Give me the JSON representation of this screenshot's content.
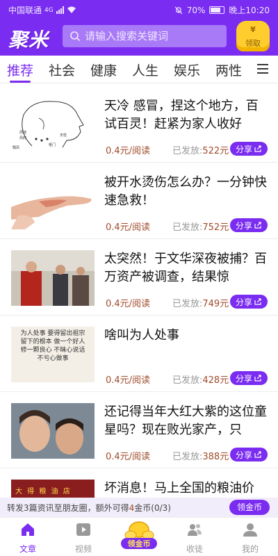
{
  "status_bar": {
    "carrier": "中国联通",
    "network": "4G",
    "battery": "70%",
    "time": "晚上10:20"
  },
  "header": {
    "logo": "聚米",
    "search_placeholder": "请输入搜索关键词",
    "reward_symbol": "¥",
    "reward_label": "领取"
  },
  "tabs": [
    "推荐",
    "社会",
    "健康",
    "人生",
    "娱乐",
    "两性"
  ],
  "active_tab": "推荐",
  "articles": [
    {
      "title": "天冷 感冒，捏这个地方，百试百灵！赶紧为家人收好",
      "price": "0.4元/阅读",
      "issued_label": "已发放:",
      "issued_amount": "522元",
      "share": "分享"
    },
    {
      "title": "被开水烫伤怎么办？一分钟快速急救！",
      "price": "0.4元/阅读",
      "issued_label": "已发放:",
      "issued_amount": "752元",
      "share": "分享"
    },
    {
      "title": "太突然！于文华深夜被捕？百万资产被调查，结果惊",
      "price": "0.4元/阅读",
      "issued_label": "已发放:",
      "issued_amount": "749元",
      "share": "分享"
    },
    {
      "title": "啥叫为人处事",
      "price": "0.4元/阅读",
      "issued_label": "已发放:",
      "issued_amount": "428元",
      "share": "分享"
    },
    {
      "title": "还记得当年大红大紫的这位童星吗？现在败光家产，只",
      "price": "0.4元/阅读",
      "issued_label": "已发放:",
      "issued_amount": "388元",
      "share": "分享"
    },
    {
      "title": "坏消息！马上全国的粮油价",
      "price": "",
      "issued_label": "",
      "issued_amount": "",
      "share": ""
    }
  ],
  "thumb_texts": {
    "acupoint_labels": [
      "风池",
      "风府",
      "翳风",
      "哑门",
      "天柱"
    ],
    "calligraphy": "为人处事 要得留出祖宗 留下的根本 做一个好人 修一颗良心 不昧心说话 不亏心做事",
    "sign": "大 得 粮 油 店"
  },
  "invite": {
    "prefix": "转发3篇资讯至朋友圈，额外可得",
    "coins": "4",
    "suffix": "金币",
    "progress": "(0/3)",
    "button": "领金币"
  },
  "bottom_nav": [
    {
      "label": "文章",
      "active": true
    },
    {
      "label": "视频",
      "active": false
    },
    {
      "label": "领金币",
      "active": false
    },
    {
      "label": "收徒",
      "active": false
    },
    {
      "label": "我的",
      "active": false
    }
  ],
  "colors": {
    "brand": "#7a2cf0",
    "price": "#a04a2a",
    "reward": "#ffce2e"
  }
}
